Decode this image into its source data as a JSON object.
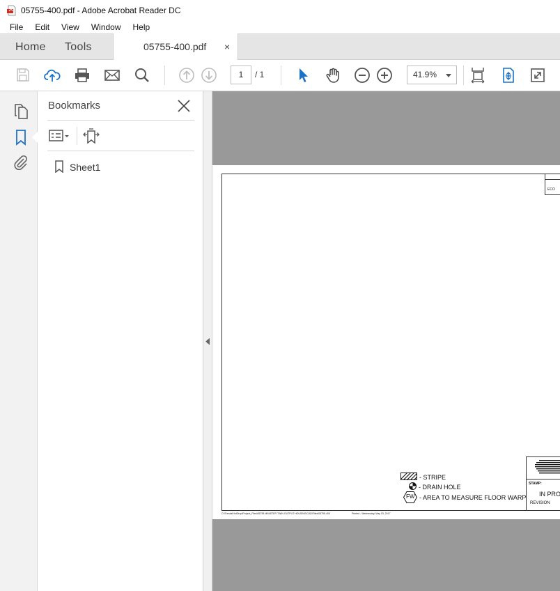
{
  "window": {
    "title": "05755-400.pdf - Adobe Acrobat Reader DC",
    "app_icon": "pdf-icon"
  },
  "menu": [
    "File",
    "Edit",
    "View",
    "Window",
    "Help"
  ],
  "tabs": {
    "home": "Home",
    "tools": "Tools",
    "document": "05755-400.pdf",
    "close": "×"
  },
  "toolbar": {
    "icons": [
      "save-icon",
      "upload-cloud-icon",
      "print-icon",
      "email-icon",
      "search-icon",
      "previous-page-icon",
      "next-page-icon",
      "select-cursor-icon",
      "hand-tool-icon",
      "zoom-out-icon",
      "zoom-in-icon",
      "fit-page-icon",
      "scroll-mode-icon",
      "full-screen-icon"
    ],
    "page_current": "1",
    "page_total": "/ 1",
    "zoom": "41.9%"
  },
  "sidebar": {
    "icons": [
      "page-thumbnails-icon",
      "bookmarks-icon",
      "attachments-icon"
    ]
  },
  "bookmarks": {
    "title": "Bookmarks",
    "items": [
      "Sheet1"
    ]
  },
  "document": {
    "eco_label": "ECO",
    "legend": {
      "stripe": "- STRIPE",
      "drain_hole": "- DRAIN HOLE",
      "floor_warp": "- AREA TO MEASURE FLOOR WARP",
      "fw_badge": "FW"
    },
    "title_block": {
      "stamp": "STAMP:",
      "status": "IN PROC",
      "revision": "REVISION"
    },
    "footer": {
      "path": "O:\\Trends\\HotDrop\\Project_Files\\05755 MINISTER TWIN OUTPUT HOUSING\\CAD\\Files\\05755-400",
      "printed": "Printed - Wednesday, May 03, 2017"
    }
  },
  "colors": {
    "accent": "#1a73c7",
    "gray_bg": "#999999"
  }
}
